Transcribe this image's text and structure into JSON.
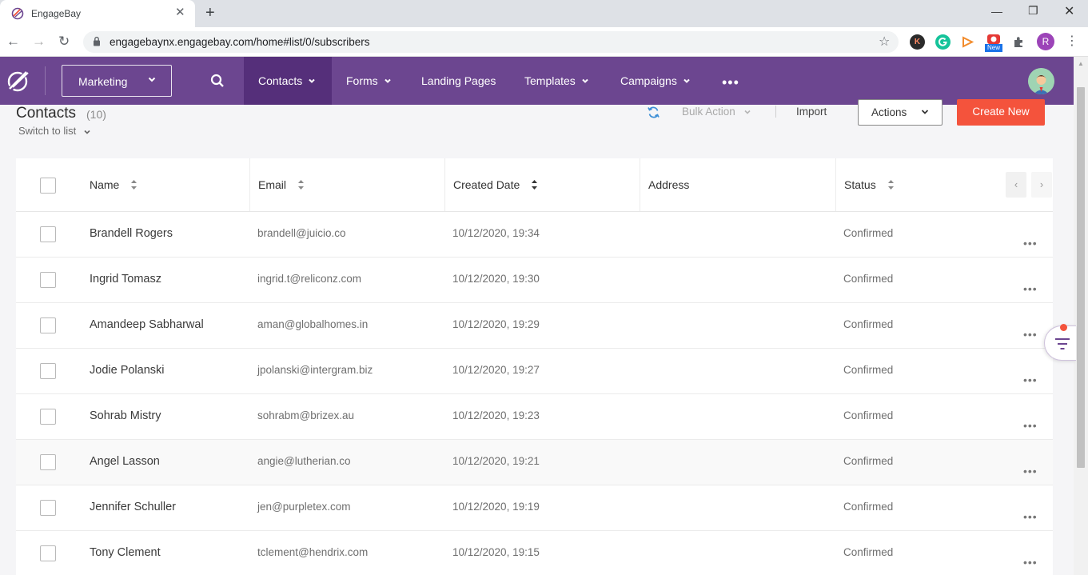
{
  "browser": {
    "tab_title": "EngageBay",
    "url": "engagebaynx.engagebay.com/home#list/0/subscribers",
    "new_badge": "New",
    "profile_initial": "R",
    "ext_k": "K"
  },
  "nav": {
    "module_select": "Marketing",
    "items": [
      {
        "label": "Contacts",
        "has_dropdown": true,
        "active": true
      },
      {
        "label": "Forms",
        "has_dropdown": true
      },
      {
        "label": "Landing Pages",
        "has_dropdown": false
      },
      {
        "label": "Templates",
        "has_dropdown": true
      },
      {
        "label": "Campaigns",
        "has_dropdown": true
      }
    ],
    "more": "•••"
  },
  "header": {
    "title": "Contacts",
    "count": "(10)",
    "switch_to_list": "Switch to list",
    "bulk_action": "Bulk Action",
    "import": "Import",
    "actions": "Actions",
    "create_new": "Create New"
  },
  "table": {
    "columns": [
      "Name",
      "Email",
      "Created Date",
      "Address",
      "Status"
    ],
    "rows": [
      {
        "name": "Brandell Rogers",
        "email": "brandell@juicio.co",
        "created": "10/12/2020, 19:34",
        "address": "",
        "status": "Confirmed"
      },
      {
        "name": "Ingrid Tomasz",
        "email": "ingrid.t@reliconz.com",
        "created": "10/12/2020, 19:30",
        "address": "",
        "status": "Confirmed"
      },
      {
        "name": "Amandeep Sabharwal",
        "email": "aman@globalhomes.in",
        "created": "10/12/2020, 19:29",
        "address": "",
        "status": "Confirmed"
      },
      {
        "name": "Jodie Polanski",
        "email": "jpolanski@intergram.biz",
        "created": "10/12/2020, 19:27",
        "address": "",
        "status": "Confirmed"
      },
      {
        "name": "Sohrab Mistry",
        "email": "sohrabm@brizex.au",
        "created": "10/12/2020, 19:23",
        "address": "",
        "status": "Confirmed"
      },
      {
        "name": "Angel Lasson",
        "email": "angie@lutherian.co",
        "created": "10/12/2020, 19:21",
        "address": "",
        "status": "Confirmed"
      },
      {
        "name": "Jennifer Schuller",
        "email": "jen@purpletex.com",
        "created": "10/12/2020, 19:19",
        "address": "",
        "status": "Confirmed"
      },
      {
        "name": "Tony Clement",
        "email": "tclement@hendrix.com",
        "created": "10/12/2020, 19:15",
        "address": "",
        "status": "Confirmed"
      }
    ],
    "row_menu": "•••"
  },
  "colors": {
    "nav_bg": "#6c4690",
    "nav_active": "#552f7a",
    "accent_orange": "#f4533c"
  }
}
